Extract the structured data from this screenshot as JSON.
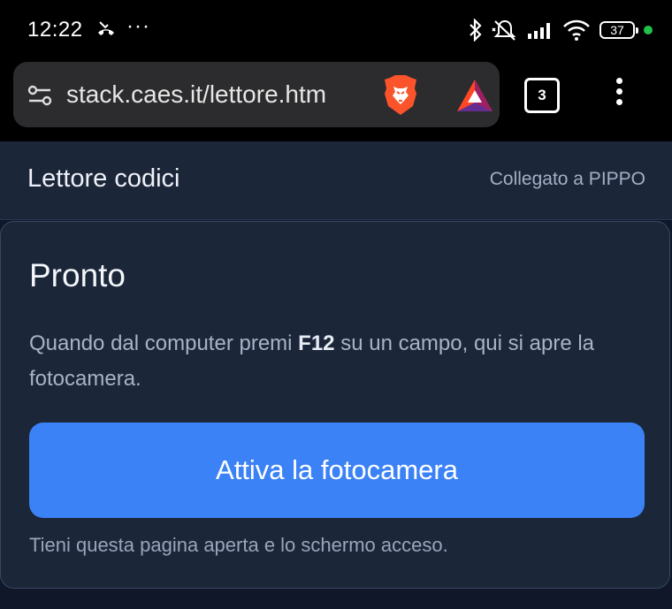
{
  "status_bar": {
    "time": "12:22",
    "dots": "···",
    "battery": "37"
  },
  "browser": {
    "url": "stack.caes.it/lettore.htm",
    "tab_count": "3"
  },
  "header": {
    "title": "Lettore codici",
    "connection": "Collegato a PIPPO"
  },
  "card": {
    "title": "Pronto",
    "desc_before": "Quando dal computer premi ",
    "desc_key": "F12",
    "desc_after": " su un campo, qui si apre la fotocamera.",
    "button_label": "Attiva la fotocamera",
    "note": "Tieni questa pagina aperta e lo schermo acceso."
  },
  "colors": {
    "accent": "#3b82f6",
    "panel": "#1b2639",
    "online_dot": "#21c24a"
  }
}
